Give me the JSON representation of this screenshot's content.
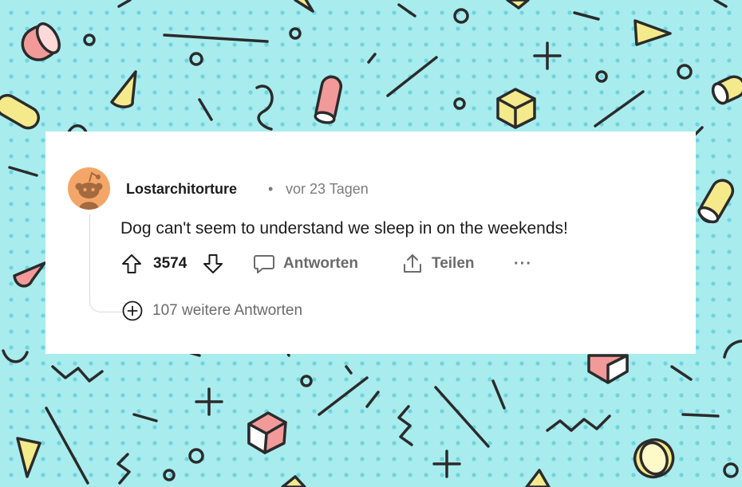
{
  "comment": {
    "username": "Lostarchitorture",
    "separator": "•",
    "timestamp": "vor 23 Tagen",
    "body": "Dog can't seem to understand we sleep in on the weekends!",
    "score": "3574"
  },
  "actions": {
    "reply_label": "Antworten",
    "share_label": "Teilen",
    "more_label": "···"
  },
  "thread": {
    "more_replies_label": "107 weitere Antworten"
  },
  "icons": {
    "avatar": "reddit-snoo-avatar-icon",
    "upvote": "arrow-up-icon",
    "downvote": "arrow-down-icon",
    "reply": "speech-bubble-icon",
    "share": "share-icon",
    "more": "ellipsis-icon",
    "expand": "plus-circle-icon"
  },
  "colors": {
    "background": "#a8ecee",
    "dots": "#6fd3e0",
    "card": "#ffffff",
    "avatar": "#f4a668",
    "pink": "#f29a9a",
    "yellow": "#f4ea8c",
    "ink": "#2b2b2b"
  }
}
